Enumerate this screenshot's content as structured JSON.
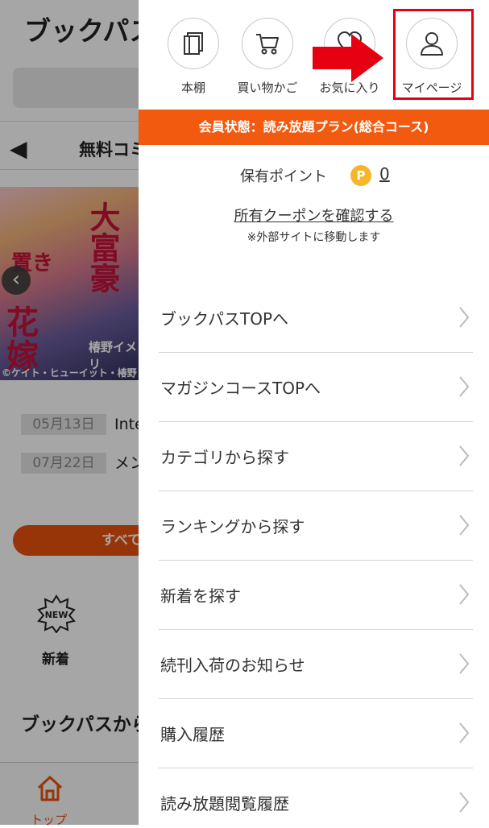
{
  "background": {
    "site_title": "ブックパス",
    "tab_title": "無料コミ",
    "cover": {
      "title_1": "大富豪",
      "title_2": "置き",
      "title_3": "花嫁",
      "author": "椿野イメリ",
      "credit": "©ケイト・ヒューイット・椿野 イメ"
    },
    "news": [
      {
        "date": "05月13日",
        "text": "Inte"
      },
      {
        "date": "07月22日",
        "text": "メン"
      }
    ],
    "all_button": "すべて",
    "new_badge": "NEW",
    "new_label": "新着",
    "section_title": "ブックパスから",
    "bottom_home_label": "トップ"
  },
  "drawer": {
    "top_nav": [
      {
        "label": "本棚",
        "icon": "bookshelf-icon"
      },
      {
        "label": "買い物かご",
        "icon": "cart-icon"
      },
      {
        "label": "お気に入り",
        "icon": "heart-icon"
      },
      {
        "label": "マイページ",
        "icon": "user-icon"
      }
    ],
    "membership_status": "会員状態：読み放題プラン(総合コース)",
    "points_label": "保有ポイント",
    "points_coin": "P",
    "points_value": "0",
    "coupon_link": "所有クーポンを確認する",
    "coupon_note": "※外部サイトに移動します",
    "menu": [
      "ブックパスTOPへ",
      "マガジンコースTOPへ",
      "カテゴリから探す",
      "ランキングから探す",
      "新着を探す",
      "続刊入荷のお知らせ",
      "購入履歴",
      "読み放題閲覧履歴"
    ]
  },
  "colors": {
    "accent": "#f15a0f",
    "highlight": "#e60012",
    "coin": "#f5b72a"
  }
}
